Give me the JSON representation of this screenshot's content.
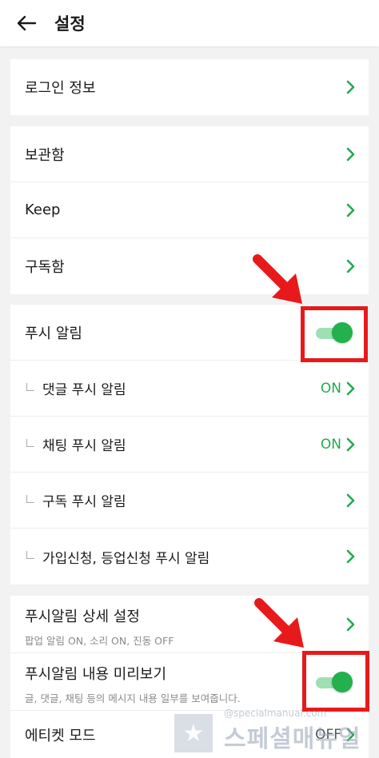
{
  "header": {
    "title": "설정"
  },
  "group_login": {
    "items": [
      {
        "label": "로그인 정보"
      }
    ]
  },
  "group_storage": {
    "items": [
      {
        "label": "보관함"
      },
      {
        "label": "Keep"
      },
      {
        "label": "구독함"
      }
    ]
  },
  "group_push": {
    "main": {
      "label": "푸시 알림",
      "enabled": true
    },
    "items": [
      {
        "label": "댓글 푸시 알림",
        "status": "ON"
      },
      {
        "label": "채팅 푸시 알림",
        "status": "ON"
      },
      {
        "label": "구독 푸시 알림"
      },
      {
        "label": "가입신청, 등업신청 푸시 알림"
      }
    ]
  },
  "group_detail": {
    "detail": {
      "label": "푸시알림 상세 설정",
      "desc": "팝업 알림 ON, 소리 ON, 진동 OFF"
    },
    "preview": {
      "label": "푸시알림 내용 미리보기",
      "desc": "글, 댓글, 채팅 등의 메시지 내용 일부를 보여줍니다.",
      "enabled": true
    },
    "emoticon": {
      "label": "에티켓 모드",
      "status": "OFF"
    }
  },
  "watermark": {
    "url": "@specialmanual.com",
    "text": "스페셜매뉴얼"
  },
  "colors": {
    "accent": "#22b14c",
    "highlight": "#e8191b",
    "on_text": "#25a94f"
  },
  "icons": {
    "back": "arrow-left-icon",
    "chevron": "chevron-right-icon",
    "pointer": "red-arrow-icon"
  }
}
